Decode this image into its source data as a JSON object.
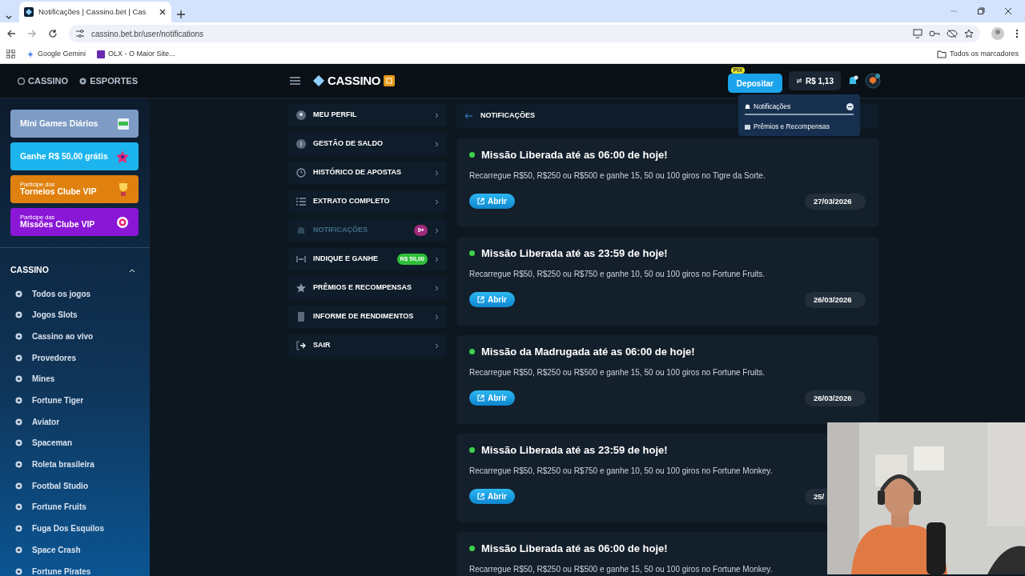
{
  "browser": {
    "tab_title": "Notificações | Cassino.bet | Cas",
    "url": "cassino.bet.br/user/notifications",
    "bookmarks": [
      "Google Gemini",
      "OLX - O Maior Site..."
    ],
    "all_bookmarks": "Todos os marcadores"
  },
  "header": {
    "nav": [
      {
        "label": "CASSINO",
        "selected": false
      },
      {
        "label": "ESPORTES",
        "selected": false
      }
    ],
    "logo": "CASSINO",
    "deposit": {
      "label": "Depositar",
      "badge": "PIX"
    },
    "balance": "R$ 1,13"
  },
  "dropdown": {
    "items": [
      {
        "label": "Notificações",
        "selected": true
      },
      {
        "label": "Prêmios e Recompensas",
        "selected": false
      }
    ]
  },
  "sidebar": {
    "promos": [
      {
        "title": "Mini Games Diários",
        "color": "#7d9bc4"
      },
      {
        "title": "Ganhe R$ 50,00 grátis",
        "color": "#1cb4ee"
      },
      {
        "subtitle": "Participe dos",
        "title": "Torneios Clube VIP",
        "color": "#e0800e"
      },
      {
        "subtitle": "Participe das",
        "title": "Missões Clube VIP",
        "color": "#8a16d6"
      }
    ],
    "section": {
      "title": "CASSINO",
      "expanded": true
    },
    "items": [
      "Todos os jogos",
      "Jogos Slots",
      "Cassino ao vivo",
      "Provedores",
      "Mines",
      "Fortune Tiger",
      "Aviator",
      "Spaceman",
      "Roleta brasileira",
      "Footbal Studio",
      "Fortune Fruits",
      "Fuga Dos Esquilos",
      "Space Crash",
      "Fortune Pirates"
    ]
  },
  "account_menu": [
    {
      "kind": "profile",
      "label": "MEU PERFIL",
      "selected": false
    },
    {
      "kind": "balance",
      "label": "GESTÃO DE SALDO",
      "selected": false
    },
    {
      "kind": "history",
      "label": "HISTÓRICO DE APOSTAS",
      "selected": false
    },
    {
      "kind": "statement",
      "label": "EXTRATO COMPLETO",
      "selected": false
    },
    {
      "kind": "notifications",
      "label": "NOTIFICAÇÕES",
      "selected": true,
      "badge": "9+",
      "color": "#a0287a"
    },
    {
      "kind": "referral",
      "label": "INDIQUE E GANHE",
      "selected": false,
      "badge": "R$ 50,00",
      "color": "#2fbf3a"
    },
    {
      "kind": "rewards",
      "label": "PRÊMIOS E RECOMPENSAS",
      "selected": false
    },
    {
      "kind": "income",
      "label": "INFORME DE RENDIMENTOS",
      "selected": false
    },
    {
      "kind": "logout",
      "label": "SAIR",
      "selected": false
    }
  ],
  "page_title": "NOTIFICAÇÕES",
  "notifications": [
    {
      "title": "Missão Liberada até as 06:00 de hoje!",
      "text": "Recarregue R$50, R$250 ou R$500 e ganhe 15, 50 ou 100 giros no Tigre da Sorte.",
      "button": "Abrir",
      "date": "27/03/2026",
      "unread": true
    },
    {
      "title": "Missão Liberada até as 23:59 de hoje!",
      "text": "Recarregue R$50, R$250 ou R$750 e ganhe 10, 50 ou 100 giros no Fortune Fruits.",
      "button": "Abrir",
      "date": "26/03/2026",
      "unread": true
    },
    {
      "title": "Missão da Madrugada até as 06:00 de hoje!",
      "text": "Recarregue R$50, R$250 ou R$500 e ganhe 15, 50 ou 100 giros no Fortune Fruits.",
      "button": "Abrir",
      "date": "26/03/2026",
      "unread": true
    },
    {
      "title": "Missão Liberada até as 23:59 de hoje!",
      "text": "Recarregue R$50, R$250 ou R$750 e ganhe 10, 50 ou 100 giros no Fortune Monkey.",
      "button": "Abrir",
      "date": "25/",
      "unread": true
    },
    {
      "title": "Missão Liberada até as 06:00 de hoje!",
      "text": "Recarregue R$50, R$250 ou R$500 e ganhe 15, 50 ou 100 giros no Fortune Monkey.",
      "unread": true
    }
  ]
}
